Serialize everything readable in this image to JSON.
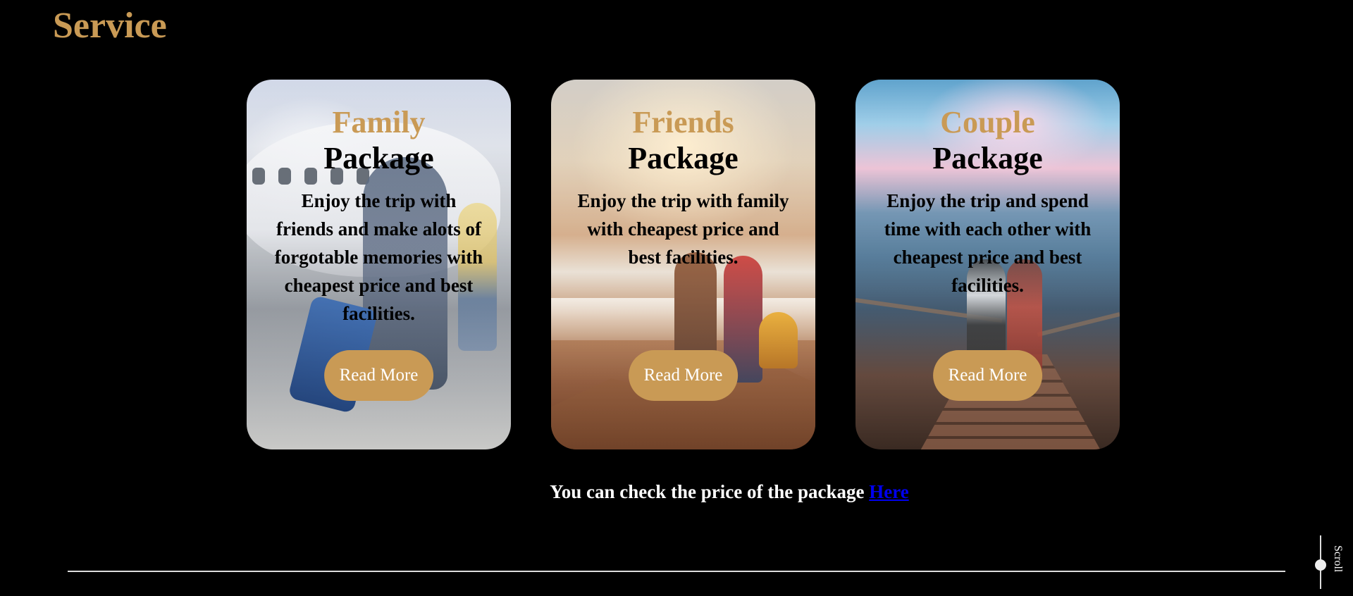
{
  "section": {
    "title": "Service"
  },
  "cards": [
    {
      "head": "Family",
      "sub": "Package",
      "desc": "Enjoy the trip with friends and make alots of forgotable memories with cheapest price and best facilities.",
      "button": "Read More"
    },
    {
      "head": "Friends",
      "sub": "Package",
      "desc": "Enjoy the trip with family with cheapest price and best facilities.",
      "button": "Read More"
    },
    {
      "head": "Couple",
      "sub": "Package",
      "desc": "Enjoy the trip and spend time with each other with cheapest price and best facilities.",
      "button": "Read More"
    }
  ],
  "price_note": {
    "text": "You can check the price of the package ",
    "link": "Here"
  },
  "scroll": {
    "label": "Scroll"
  },
  "colors": {
    "accent": "#c99a55",
    "background": "#000000",
    "link": "#0000ee"
  }
}
